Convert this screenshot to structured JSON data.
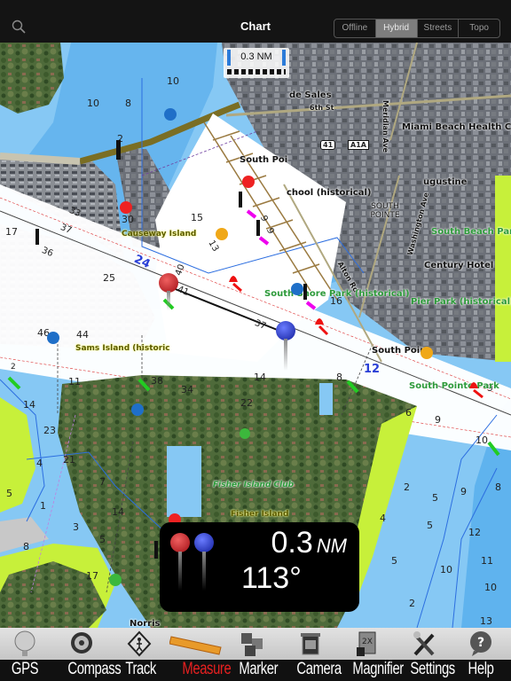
{
  "header": {
    "title": "Chart",
    "search_icon": "search-icon",
    "map_modes": [
      {
        "label": "Offline",
        "active": false
      },
      {
        "label": "Hybrid",
        "active": true
      },
      {
        "label": "Streets",
        "active": false
      },
      {
        "label": "Topo",
        "active": false
      }
    ]
  },
  "map": {
    "scale_bar": {
      "label": "0.3 NM"
    },
    "channel_labels": [
      "24",
      "12"
    ],
    "place_labels": [
      "de Sales",
      "6th St",
      "Miami Beach Health Ce",
      "South Poi",
      "chool (historical)",
      "ugustine",
      "SOUTH POINTE",
      "Century Hotel",
      "South Poir",
      "Norris",
      "Meridian Ave",
      "Washington Ave",
      "Alton Rd"
    ],
    "park_labels": [
      "South Beach Par",
      "South Shore Park (historical)",
      "Pier Park (historical)",
      "South Pointe Park",
      "Fisher Island Club"
    ],
    "island_labels": [
      "Causeway Island",
      "Sams Island (historic",
      "Fisher Island"
    ],
    "road_shields": [
      "41",
      "A1A"
    ],
    "depths": [
      {
        "v": "8"
      },
      {
        "v": "10"
      },
      {
        "v": "10"
      },
      {
        "v": "8"
      },
      {
        "v": "2"
      },
      {
        "v": "30"
      },
      {
        "v": "33"
      },
      {
        "v": "15"
      },
      {
        "v": "17"
      },
      {
        "v": "37"
      },
      {
        "v": "36"
      },
      {
        "v": "13"
      },
      {
        "v": "40"
      },
      {
        "v": "41"
      },
      {
        "v": "25"
      },
      {
        "v": "9"
      },
      {
        "v": "9"
      },
      {
        "v": "13"
      },
      {
        "v": "16"
      },
      {
        "v": "37"
      },
      {
        "v": "46"
      },
      {
        "v": "44"
      },
      {
        "v": "2"
      },
      {
        "v": "11"
      },
      {
        "v": "38"
      },
      {
        "v": "34"
      },
      {
        "v": "14"
      },
      {
        "v": "22"
      },
      {
        "v": "8"
      },
      {
        "v": "9"
      },
      {
        "v": "6"
      },
      {
        "v": "9"
      },
      {
        "v": "14"
      },
      {
        "v": "23"
      },
      {
        "v": "21"
      },
      {
        "v": "4"
      },
      {
        "v": "5"
      },
      {
        "v": "1"
      },
      {
        "v": "7"
      },
      {
        "v": "3"
      },
      {
        "v": "14"
      },
      {
        "v": "5"
      },
      {
        "v": "8"
      },
      {
        "v": "17"
      },
      {
        "v": "10"
      },
      {
        "v": "2"
      },
      {
        "v": "5"
      },
      {
        "v": "9"
      },
      {
        "v": "8"
      },
      {
        "v": "4"
      },
      {
        "v": "5"
      },
      {
        "v": "12"
      },
      {
        "v": "5"
      },
      {
        "v": "10"
      },
      {
        "v": "11"
      },
      {
        "v": "10"
      },
      {
        "v": "2"
      },
      {
        "v": "13"
      }
    ]
  },
  "measure": {
    "distance": "0.3",
    "unit": "NM",
    "bearing": "113°",
    "start_pin_color": "#c0161c",
    "end_pin_color": "#1f2fc8"
  },
  "toolbar": {
    "items": [
      {
        "label": "GPS",
        "icon": "gps-icon",
        "active": false
      },
      {
        "label": "Compass",
        "icon": "compass-icon",
        "active": false
      },
      {
        "label": "Track",
        "icon": "track-icon",
        "active": false
      },
      {
        "label": "Measure",
        "icon": "ruler-icon",
        "active": true
      },
      {
        "label": "Marker",
        "icon": "marker-icon",
        "active": false
      },
      {
        "label": "Camera",
        "icon": "camera-icon",
        "active": false
      },
      {
        "label": "Magnifier",
        "icon": "magnifier-icon",
        "active": false
      },
      {
        "label": "Settings",
        "icon": "settings-icon",
        "active": false
      },
      {
        "label": "Help",
        "icon": "help-icon",
        "active": false
      }
    ]
  },
  "colors": {
    "active_label": "#e82020",
    "water_shallow": "#86c8f4",
    "water_deep": "#5fb3ee",
    "land": "#c7f03a",
    "channel": "#ffffff"
  }
}
